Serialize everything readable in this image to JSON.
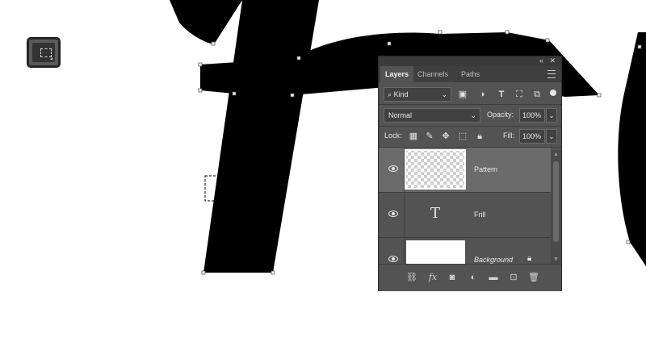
{
  "panel": {
    "tabs": [
      "Layers",
      "Channels",
      "Paths"
    ],
    "filter": {
      "kind": "Kind"
    },
    "blend_mode": "Normal",
    "opacity_label": "Opacity:",
    "opacity_value": "100%",
    "lock_label": "Lock:",
    "fill_label": "Fill:",
    "fill_value": "100%",
    "layers": [
      {
        "name": "Pattern",
        "type": "pattern",
        "visible": true,
        "selected": true
      },
      {
        "name": "Frill",
        "type": "text",
        "visible": true,
        "selected": false
      },
      {
        "name": "Background",
        "type": "background",
        "visible": true,
        "selected": false,
        "locked": true
      }
    ]
  },
  "toolbar": {
    "active_tool_icon": "rectangular-marquee-icon"
  },
  "colors": {
    "panel_bg": "#535353",
    "selected_row": "#6b6b6b",
    "text": "#e6e6e6"
  }
}
